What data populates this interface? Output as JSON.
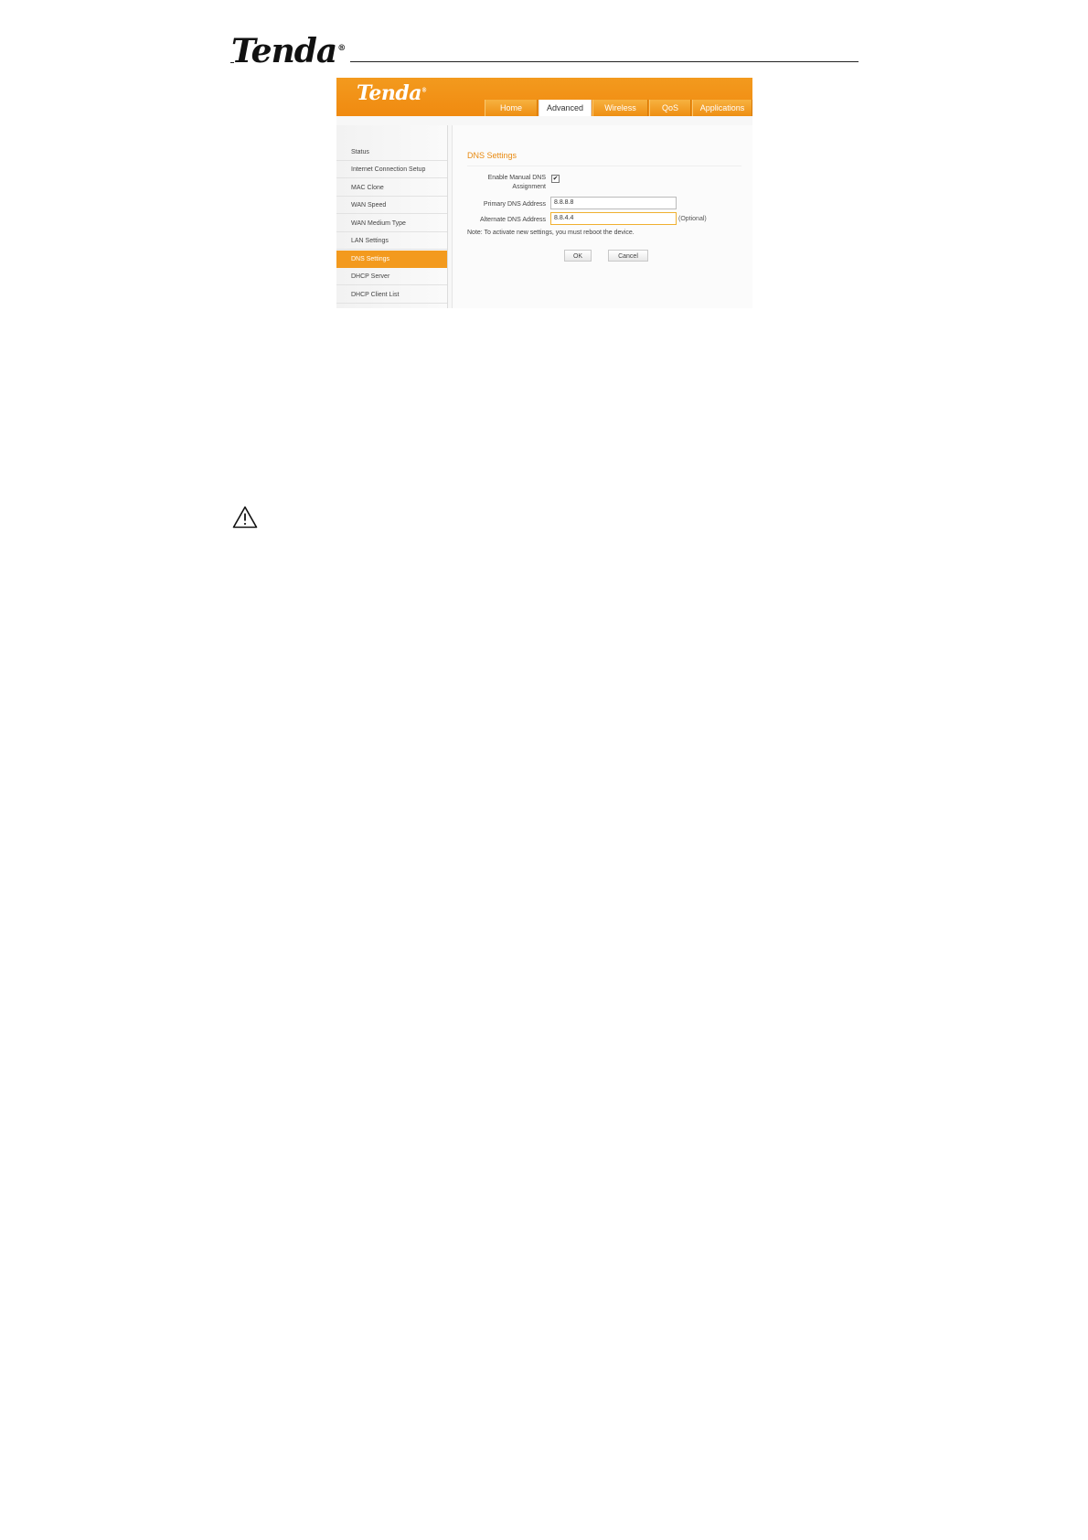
{
  "doc": {
    "logo": "Tenda",
    "reg": "®"
  },
  "router": {
    "logo": "Tenda",
    "reg": "®",
    "tabs": [
      "Home",
      "Advanced",
      "Wireless",
      "QoS",
      "Applications"
    ],
    "active_tab": "Advanced",
    "sidebar": [
      "Status",
      "Internet Connection Setup",
      "MAC Clone",
      "WAN Speed",
      "WAN Medium Type",
      "LAN Settings",
      "DNS Settings",
      "DHCP Server",
      "DHCP Client List"
    ],
    "active_sidebar": "DNS Settings"
  },
  "dns": {
    "title": "DNS Settings",
    "enable_label_1": "Enable Manual DNS",
    "enable_label_2": "Assignment",
    "enable_checked": true,
    "check_mark": "✔",
    "primary_label": "Primary DNS Address",
    "primary_value": "8.8.8.8",
    "alternate_label": "Alternate DNS Address",
    "alternate_value": "8.8.4.4",
    "optional": "(Optional)",
    "note": "Note:  To activate new settings, you must reboot the device.",
    "ok": "OK",
    "cancel": "Cancel"
  },
  "icons": {
    "warning": "warning-triangle-icon"
  }
}
